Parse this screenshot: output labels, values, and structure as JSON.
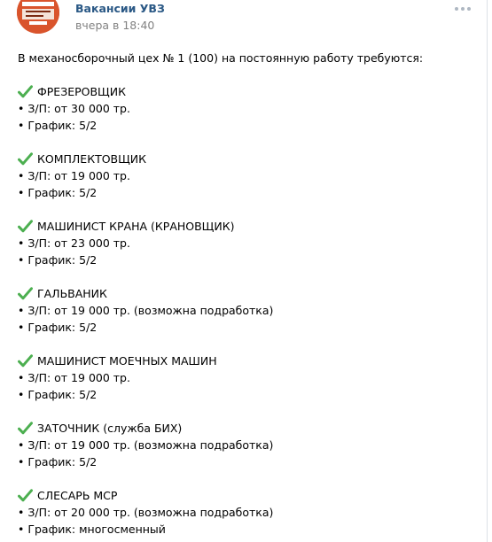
{
  "post": {
    "author": "Вакансии УВЗ",
    "time": "вчера в 18:40",
    "intro": "В механосборочный цех № 1 (100) на постоянную работу требуются:",
    "check_icon_color": "#4caf50",
    "jobs": [
      {
        "title": "ФРЕЗЕРОВЩИК",
        "salary": "• З/П: от 30 000 тр.",
        "schedule": "• График: 5/2"
      },
      {
        "title": "КОМПЛЕКТОВЩИК",
        "salary": "• З/П: от 19 000 тр.",
        "schedule": "• График: 5/2"
      },
      {
        "title": "МАШИНИСТ КРАНА (КРАНОВЩИК)",
        "salary": "• З/П: от 23 000 тр.",
        "schedule": "• График: 5/2"
      },
      {
        "title": "ГАЛЬВАНИК",
        "salary": "• З/П: от 19 000 тр. (возможна подработка)",
        "schedule": "• График: 5/2"
      },
      {
        "title": "МАШИНИСТ МОЕЧНЫХ МАШИН",
        "salary": "• З/П: от 19 000 тр.",
        "schedule": "• График: 5/2"
      },
      {
        "title": "ЗАТОЧНИК (служба БИХ)",
        "salary": "• З/П: от 19 000 тр. (возможна подработка)",
        "schedule": "• График: 5/2"
      },
      {
        "title": "СЛЕСАРЬ МСР",
        "salary": "• З/П: от 20 000 тр. (возможна подработка)",
        "schedule": "• График: многосменный"
      }
    ]
  }
}
